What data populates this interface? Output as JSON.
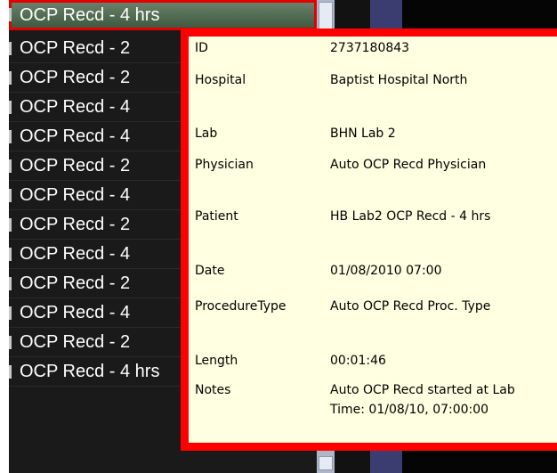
{
  "list": {
    "items": [
      {
        "text": "OCP Recd - 4 hrs",
        "selected": true
      },
      {
        "text": "OCP Recd - 2"
      },
      {
        "text": "OCP Recd - 2"
      },
      {
        "text": "OCP Recd - 4"
      },
      {
        "text": "OCP Recd - 4"
      },
      {
        "text": "OCP Recd - 2"
      },
      {
        "text": "OCP Recd - 4"
      },
      {
        "text": "OCP Recd - 2"
      },
      {
        "text": "OCP Recd - 4"
      },
      {
        "text": "OCP Recd - 2"
      },
      {
        "text": "OCP Recd - 4"
      },
      {
        "text": "OCP Recd - 2"
      },
      {
        "text": "OCP Recd - 4 hrs"
      }
    ]
  },
  "tooltip": {
    "rows": [
      {
        "label": "ID",
        "value": "2737180843"
      },
      {
        "label": "Hospital",
        "value": "Baptist Hospital North"
      },
      {
        "label": "Lab",
        "value": "BHN Lab 2"
      },
      {
        "label": "Physician",
        "value": "Auto OCP Recd Physician"
      },
      {
        "label": "Patient",
        "value": "HB Lab2 OCP Recd - 4 hrs"
      },
      {
        "label": "Date",
        "value": "01/08/2010 07:00"
      },
      {
        "label": "ProcedureType",
        "value": "Auto OCP Recd Proc. Type"
      },
      {
        "label": "Length",
        "value": "00:01:46"
      },
      {
        "label": "Notes",
        "value": "Auto OCP Recd started at Lab Time: 01/08/10, 07:00:00"
      }
    ]
  },
  "colors": {
    "highlight_border": "#ff0000",
    "tooltip_background": "#ffffe1",
    "list_background": "#1a1a1a",
    "selected_item": "#4f6b50"
  }
}
